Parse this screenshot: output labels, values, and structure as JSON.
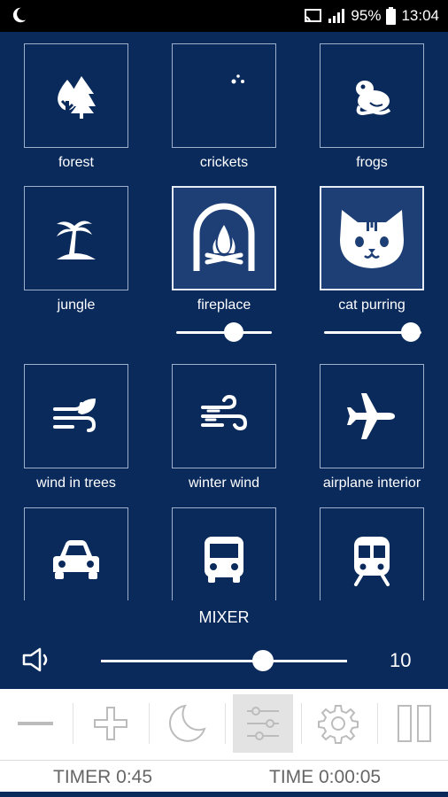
{
  "status_bar": {
    "battery": "95%",
    "time": "13:04"
  },
  "sounds": [
    {
      "label": "forest",
      "icon": "trees-icon",
      "active": false
    },
    {
      "label": "crickets",
      "icon": "moon-stars-icon",
      "active": false
    },
    {
      "label": "frogs",
      "icon": "frog-icon",
      "active": false
    },
    {
      "label": "jungle",
      "icon": "palm-tree-icon",
      "active": false
    },
    {
      "label": "fireplace",
      "icon": "fireplace-icon",
      "active": true,
      "volume": 0.6
    },
    {
      "label": "cat purring",
      "icon": "cat-icon",
      "active": true,
      "volume": 0.9
    },
    {
      "label": "wind in trees",
      "icon": "wind-leaf-icon",
      "active": false
    },
    {
      "label": "winter wind",
      "icon": "wind-icon",
      "active": false
    },
    {
      "label": "airplane interior",
      "icon": "airplane-icon",
      "active": false
    },
    {
      "label": "",
      "icon": "car-icon",
      "active": false
    },
    {
      "label": "",
      "icon": "bus-icon",
      "active": false
    },
    {
      "label": "",
      "icon": "train-icon",
      "active": false
    }
  ],
  "mixer": {
    "title": "MIXER",
    "master_value": "10",
    "master_level": 0.66
  },
  "toolbar": {
    "buttons": [
      "minus-icon",
      "plus-icon",
      "moon-icon",
      "mixer-sliders-icon",
      "gear-icon",
      "pause-icon"
    ],
    "selected": "mixer-sliders-icon"
  },
  "footer": {
    "timer": "TIMER  0:45",
    "time": "TIME  0:00:05"
  }
}
